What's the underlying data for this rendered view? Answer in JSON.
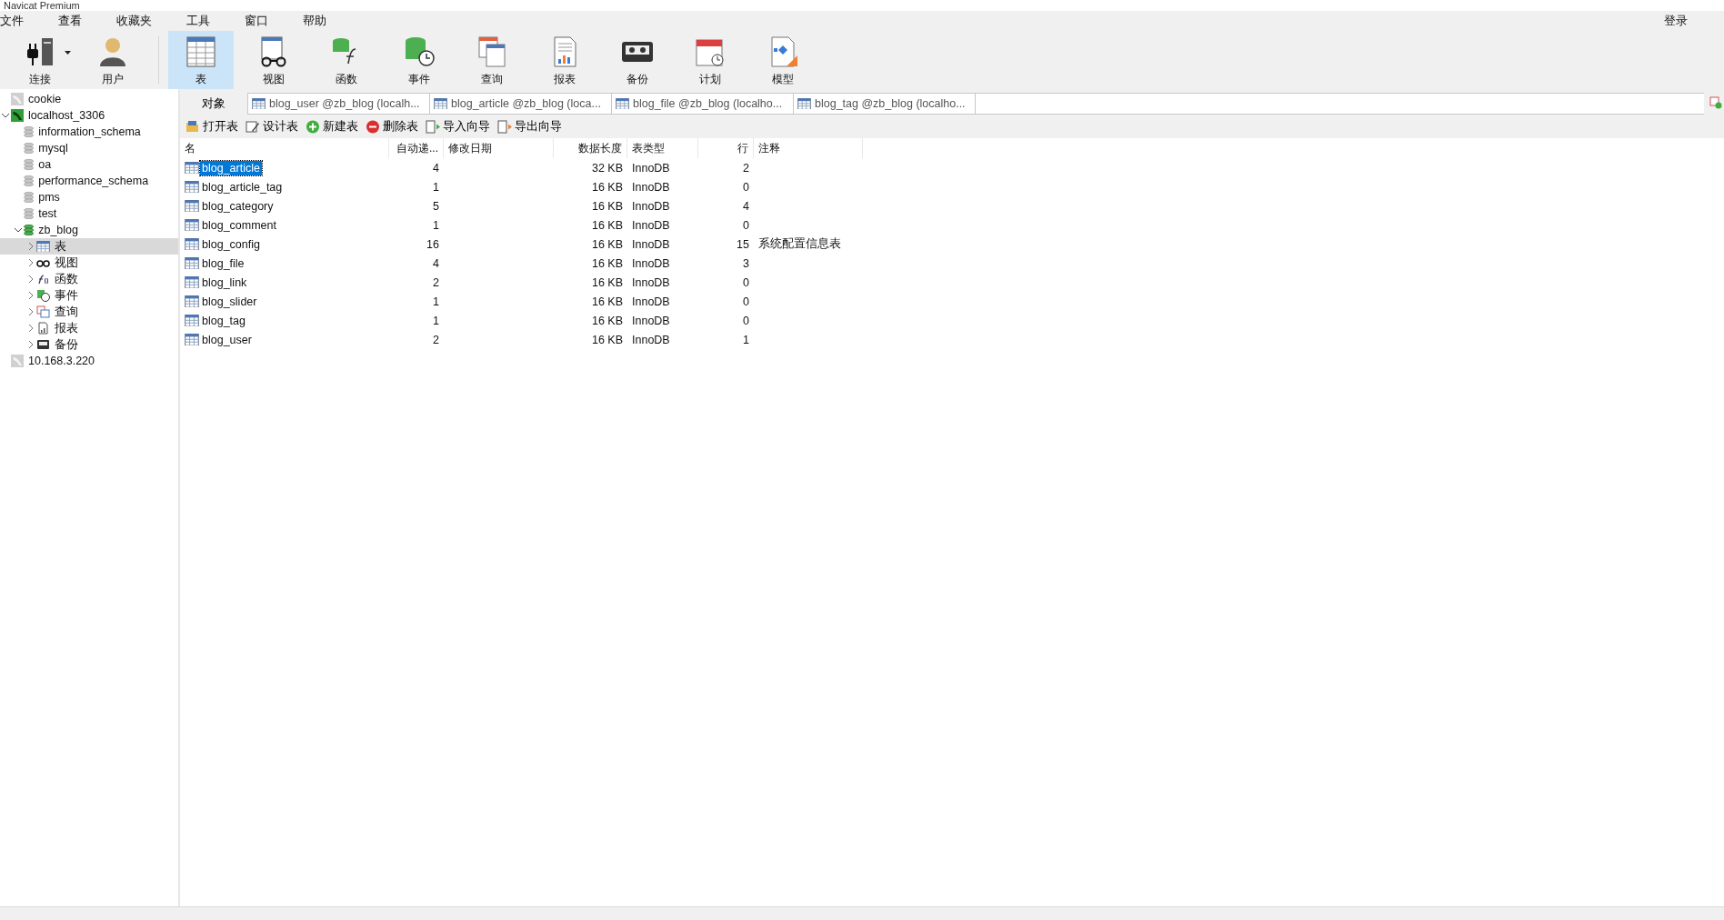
{
  "window": {
    "title": "Navicat Premium"
  },
  "menu": [
    "文件",
    "查看",
    "收藏夹",
    "工具",
    "窗口",
    "帮助"
  ],
  "login": "登录",
  "toolbar": [
    {
      "label": "连接",
      "kind": "connect",
      "selected": false,
      "dropdown": true
    },
    {
      "label": "用户",
      "kind": "user",
      "selected": false,
      "dropdown": false
    },
    {
      "label": "表",
      "kind": "table",
      "selected": true,
      "dropdown": false
    },
    {
      "label": "视图",
      "kind": "view",
      "selected": false,
      "dropdown": false
    },
    {
      "label": "函数",
      "kind": "function",
      "selected": false,
      "dropdown": false
    },
    {
      "label": "事件",
      "kind": "event",
      "selected": false,
      "dropdown": false
    },
    {
      "label": "查询",
      "kind": "query",
      "selected": false,
      "dropdown": false
    },
    {
      "label": "报表",
      "kind": "report",
      "selected": false,
      "dropdown": false
    },
    {
      "label": "备份",
      "kind": "backup",
      "selected": false,
      "dropdown": false
    },
    {
      "label": "计划",
      "kind": "schedule",
      "selected": false,
      "dropdown": false
    },
    {
      "label": "模型",
      "kind": "model",
      "selected": false,
      "dropdown": false
    }
  ],
  "sidebar": {
    "items": [
      {
        "label": "cookie",
        "kind": "connection",
        "connected": false,
        "selected": false
      },
      {
        "label": "localhost_3306",
        "kind": "connection",
        "connected": true,
        "expanded": true,
        "selected": false,
        "children": [
          {
            "label": "information_schema",
            "kind": "database",
            "connected": false,
            "selected": false
          },
          {
            "label": "mysql",
            "kind": "database",
            "connected": false,
            "selected": false
          },
          {
            "label": "oa",
            "kind": "database",
            "connected": false,
            "selected": false
          },
          {
            "label": "performance_schema",
            "kind": "database",
            "connected": false,
            "selected": false
          },
          {
            "label": "pms",
            "kind": "database",
            "connected": false,
            "selected": false
          },
          {
            "label": "test",
            "kind": "database",
            "connected": false,
            "selected": false
          },
          {
            "label": "zb_blog",
            "kind": "database",
            "connected": true,
            "expanded": true,
            "selected": false,
            "children": [
              {
                "label": "表",
                "kind": "table",
                "expanded": false,
                "selected": true
              },
              {
                "label": "视图",
                "kind": "view",
                "expanded": false,
                "selected": false
              },
              {
                "label": "函数",
                "kind": "function",
                "expanded": false,
                "selected": false
              },
              {
                "label": "事件",
                "kind": "event",
                "expanded": false,
                "selected": false
              },
              {
                "label": "查询",
                "kind": "query",
                "expanded": false,
                "selected": false
              },
              {
                "label": "报表",
                "kind": "report",
                "expanded": false,
                "selected": false
              },
              {
                "label": "备份",
                "kind": "backup",
                "expanded": false,
                "selected": false
              }
            ]
          }
        ]
      },
      {
        "label": "10.168.3.220",
        "kind": "connection",
        "connected": false,
        "selected": false
      }
    ]
  },
  "tabs": [
    {
      "label": "对象",
      "kind": "objects",
      "selected": true
    },
    {
      "label": "blog_user @zb_blog (localh...",
      "kind": "table",
      "selected": false
    },
    {
      "label": "blog_article @zb_blog (loca...",
      "kind": "table",
      "selected": false
    },
    {
      "label": "blog_file @zb_blog (localho...",
      "kind": "table",
      "selected": false
    },
    {
      "label": "blog_tag @zb_blog (localho...",
      "kind": "table",
      "selected": false
    }
  ],
  "actions": [
    {
      "label": "打开表",
      "kind": "open"
    },
    {
      "label": "设计表",
      "kind": "design"
    },
    {
      "label": "新建表",
      "kind": "new"
    },
    {
      "label": "删除表",
      "kind": "delete"
    },
    {
      "label": "导入向导",
      "kind": "import"
    },
    {
      "label": "导出向导",
      "kind": "export"
    }
  ],
  "table": {
    "columns": [
      "名",
      "自动递...",
      "修改日期",
      "数据长度",
      "表类型",
      "行",
      "注释"
    ],
    "rows": [
      {
        "name": "blog_article",
        "auto_increment": "4",
        "modified": "",
        "size": "32 KB",
        "engine": "InnoDB",
        "rows": "2",
        "comment": "",
        "selected": true
      },
      {
        "name": "blog_article_tag",
        "auto_increment": "1",
        "size": "16 KB",
        "engine": "InnoDB",
        "rows": "0",
        "selected": false
      },
      {
        "name": "blog_category",
        "auto_increment": "5",
        "size": "16 KB",
        "engine": "InnoDB",
        "rows": "4",
        "selected": false
      },
      {
        "name": "blog_comment",
        "auto_increment": "1",
        "size": "16 KB",
        "engine": "InnoDB",
        "rows": "0",
        "selected": false
      },
      {
        "name": "blog_config",
        "auto_increment": "16",
        "size": "16 KB",
        "engine": "InnoDB",
        "rows": "15",
        "comment": "系统配置信息表",
        "selected": false
      },
      {
        "name": "blog_file",
        "auto_increment": "4",
        "size": "16 KB",
        "engine": "InnoDB",
        "rows": "3",
        "selected": false
      },
      {
        "name": "blog_link",
        "auto_increment": "2",
        "size": "16 KB",
        "engine": "InnoDB",
        "rows": "0",
        "selected": false
      },
      {
        "name": "blog_slider",
        "auto_increment": "1",
        "size": "16 KB",
        "engine": "InnoDB",
        "rows": "0",
        "selected": false
      },
      {
        "name": "blog_tag",
        "auto_increment": "1",
        "size": "16 KB",
        "engine": "InnoDB",
        "rows": "0",
        "selected": false
      },
      {
        "name": "blog_user",
        "auto_increment": "2",
        "size": "16 KB",
        "engine": "InnoDB",
        "rows": "1",
        "selected": false
      }
    ]
  }
}
